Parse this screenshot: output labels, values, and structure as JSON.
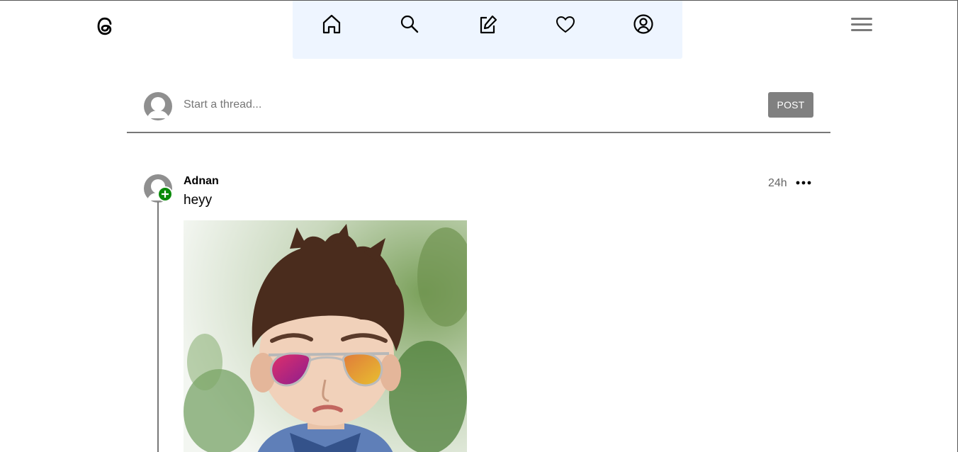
{
  "app": {
    "logo_icon": "threads-logo-icon"
  },
  "nav": {
    "items": [
      {
        "icon": "home-icon"
      },
      {
        "icon": "search-icon"
      },
      {
        "icon": "edit-icon"
      },
      {
        "icon": "heart-icon"
      },
      {
        "icon": "user-circle-icon"
      }
    ],
    "background": "#eef5ff"
  },
  "menu_icon": "hamburger-menu-icon",
  "composer": {
    "placeholder": "Start a thread...",
    "post_label": "POST"
  },
  "thread": {
    "username": "Adnan",
    "text": "heyy",
    "time": "24h",
    "image_description_icon": "photo-icon"
  },
  "colors": {
    "accent_follow": "#0a8a0a",
    "button": "#808080"
  }
}
